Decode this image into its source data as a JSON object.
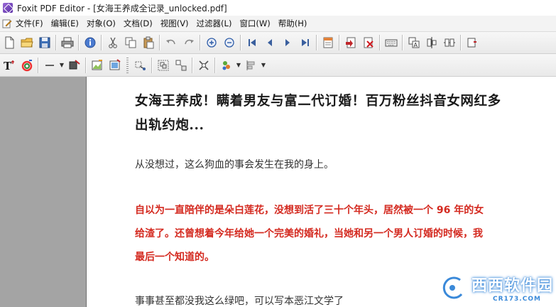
{
  "window": {
    "title": "Foxit PDF Editor - [女海王养成全记录_unlocked.pdf]"
  },
  "menubar": {
    "items": [
      "文件(F)",
      "编辑(E)",
      "对象(O)",
      "文档(D)",
      "视图(V)",
      "过滤器(L)",
      "窗口(W)",
      "帮助(H)"
    ]
  },
  "toolbar1": {
    "icons": [
      "new-file-icon",
      "open-folder-icon",
      "save-icon",
      "print-icon",
      "info-icon",
      "cut-icon",
      "copy-icon",
      "paste-icon",
      "undo-icon",
      "redo-icon",
      "zoom-in-icon",
      "zoom-out-icon",
      "first-page-icon",
      "prev-page-icon",
      "next-page-icon",
      "last-page-icon",
      "page-properties-icon",
      "insert-page-icon",
      "delete-page-icon",
      "keyboard-icon",
      "text-tool-icon",
      "align-icon",
      "distribute-icon",
      "more-icon"
    ]
  },
  "toolbar2": {
    "icons": [
      "text-object-icon",
      "color-circle-icon",
      "line-tool-icon",
      "shape-fill-icon",
      "edit-image-icon",
      "image-object-icon",
      "link-icon",
      "group-icon",
      "ungroup-icon",
      "break-icon",
      "layer-icon",
      "align-object-icon"
    ]
  },
  "document": {
    "title_line1": "女海王养成！瞒着男友与富二代订婚！百万粉丝抖音女网红多",
    "title_line2": "出轨约炮...",
    "para_plain": "从没想过，这么狗血的事会发生在我的身上。",
    "para_red_1": "自以为一直陪伴的是朵白莲花，没想到活了三十个年头，居然被一个 96 年的女",
    "para_red_2": "给渣了。还曾想着今年给她一个完美的婚礼，当她和另一个男人订婚的时候，我",
    "para_red_3": "最后一个知道的。",
    "para_cut": "事事甚至都没我这么绿吧，可以写本恶江文学了"
  },
  "watermark": {
    "big": "西西软件园",
    "small": "CR173.COM"
  },
  "colors": {
    "red_text": "#d42a20",
    "side_pane": "#a4a4a4",
    "watermark_blue": "#2a7fd6"
  }
}
